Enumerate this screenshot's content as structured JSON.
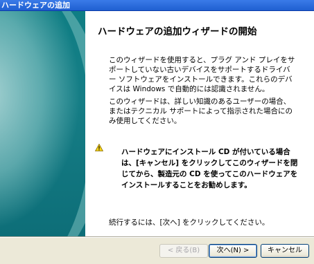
{
  "window": {
    "title": "ハードウェアの追加"
  },
  "wizard": {
    "heading": "ハードウェアの追加ウィザードの開始",
    "paragraph1": "このウィザードを使用すると、プラグ アンド プレイをサポートしていない古いデバイスをサポートするドライバー ソフトウェアをインストールできます。これらのデバイスは Windows で自動的には認識されません。",
    "paragraph2": "このウィザードは、詳しい知識のあるユーザーの場合、またはテクニカル サポートによって指示された場合にのみ使用してください。",
    "warning": "ハードウェアにインストール CD が付いている場合は、[キャンセル] をクリックしてこのウィザードを閉じてから、製造元の CD を使ってこのハードウェアをインストールすることをお勧めします。",
    "continue_text": "続行するには、[次へ] をクリックしてください。"
  },
  "buttons": {
    "back": "< 戻る(B)",
    "next": "次へ(N) >",
    "cancel": "キャンセル"
  },
  "icons": {
    "warning": "warning-icon"
  },
  "colors": {
    "side_panel": "#0f7f86",
    "title_bar": "#1f5fd1"
  }
}
